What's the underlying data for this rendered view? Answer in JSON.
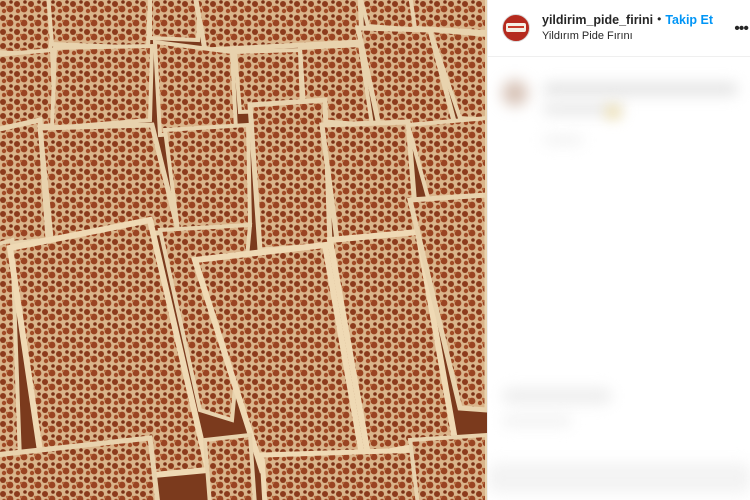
{
  "post": {
    "username": "yildirim_pide_firini",
    "separator": "•",
    "follow_label": "Takip Et",
    "location": "Yildırım Pide Fırını",
    "more_icon": "ellipsis-icon"
  },
  "image": {
    "subject": "lahmacun-flatbreads-photo"
  },
  "colors": {
    "follow_blue": "#0095f6",
    "text_dark": "#262626",
    "border": "#efefef"
  }
}
